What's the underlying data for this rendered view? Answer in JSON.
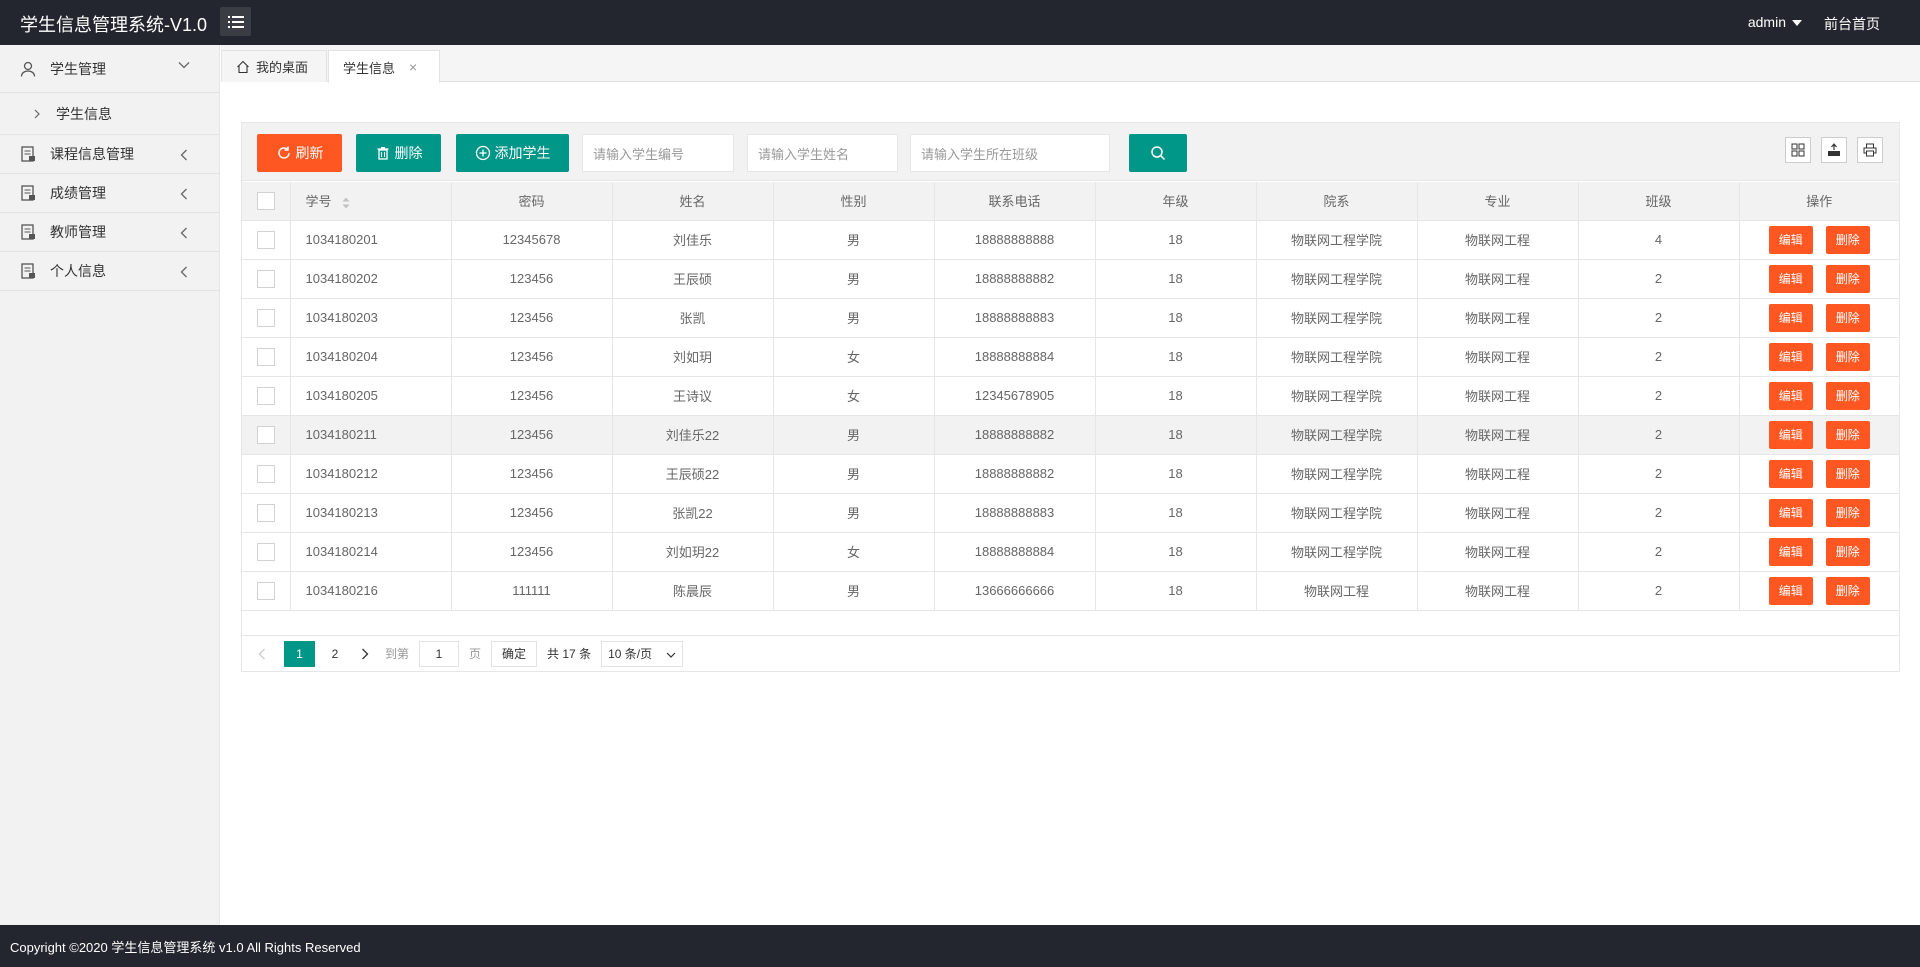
{
  "header": {
    "title": "学生信息管理系统-V1.0",
    "user": "admin",
    "front_home": "前台首页"
  },
  "sidebar": {
    "items": [
      {
        "label": "学生管理",
        "icon": "user-icon",
        "expanded": true
      },
      {
        "label": "学生信息",
        "icon": "chevron-right-icon",
        "sub": true
      },
      {
        "label": "课程信息管理",
        "icon": "document-icon"
      },
      {
        "label": "成绩管理",
        "icon": "document-icon"
      },
      {
        "label": "教师管理",
        "icon": "document-icon"
      },
      {
        "label": "个人信息",
        "icon": "document-icon"
      }
    ]
  },
  "tabs": [
    {
      "label": "我的桌面"
    },
    {
      "label": "学生信息",
      "close": "×"
    }
  ],
  "toolbar": {
    "refresh_label": "刷新",
    "delete_label": "删除",
    "add_label": "添加学生",
    "id_placeholder": "请输入学生编号",
    "name_placeholder": "请输入学生姓名",
    "class_placeholder": "请输入学生所在班级"
  },
  "table": {
    "headers": [
      "学号",
      "密码",
      "姓名",
      "性别",
      "联系电话",
      "年级",
      "院系",
      "专业",
      "班级",
      "操作"
    ],
    "edit_label": "编辑",
    "delete_label": "删除",
    "rows": [
      [
        "1034180201",
        "12345678",
        "刘佳乐",
        "男",
        "18888888888",
        "18",
        "物联网工程学院",
        "物联网工程",
        "4"
      ],
      [
        "1034180202",
        "123456",
        "王辰硕",
        "男",
        "18888888882",
        "18",
        "物联网工程学院",
        "物联网工程",
        "2"
      ],
      [
        "1034180203",
        "123456",
        "张凯",
        "男",
        "18888888883",
        "18",
        "物联网工程学院",
        "物联网工程",
        "2"
      ],
      [
        "1034180204",
        "123456",
        "刘如玥",
        "女",
        "18888888884",
        "18",
        "物联网工程学院",
        "物联网工程",
        "2"
      ],
      [
        "1034180205",
        "123456",
        "王诗议",
        "女",
        "12345678905",
        "18",
        "物联网工程学院",
        "物联网工程",
        "2"
      ],
      [
        "1034180211",
        "123456",
        "刘佳乐22",
        "男",
        "18888888882",
        "18",
        "物联网工程学院",
        "物联网工程",
        "2"
      ],
      [
        "1034180212",
        "123456",
        "王辰硕22",
        "男",
        "18888888882",
        "18",
        "物联网工程学院",
        "物联网工程",
        "2"
      ],
      [
        "1034180213",
        "123456",
        "张凯22",
        "男",
        "18888888883",
        "18",
        "物联网工程学院",
        "物联网工程",
        "2"
      ],
      [
        "1034180214",
        "123456",
        "刘如玥22",
        "女",
        "18888888884",
        "18",
        "物联网工程学院",
        "物联网工程",
        "2"
      ],
      [
        "1034180216",
        "111111",
        "陈晨辰",
        "男",
        "13666666666",
        "18",
        "物联网工程",
        "物联网工程",
        "2"
      ]
    ]
  },
  "pager": {
    "current": "1",
    "next_page": "2",
    "goto_label": "到第",
    "goto_value": "1",
    "page_unit": "页",
    "confirm": "确定",
    "total": "共 17 条",
    "page_size": "10 条/页"
  },
  "footer": {
    "text": "Copyright ©2020 学生信息管理系统 v1.0 All Rights Reserved"
  },
  "colors": {
    "header_bg": "#23262e",
    "primary": "#009688",
    "danger": "#ff5722"
  }
}
